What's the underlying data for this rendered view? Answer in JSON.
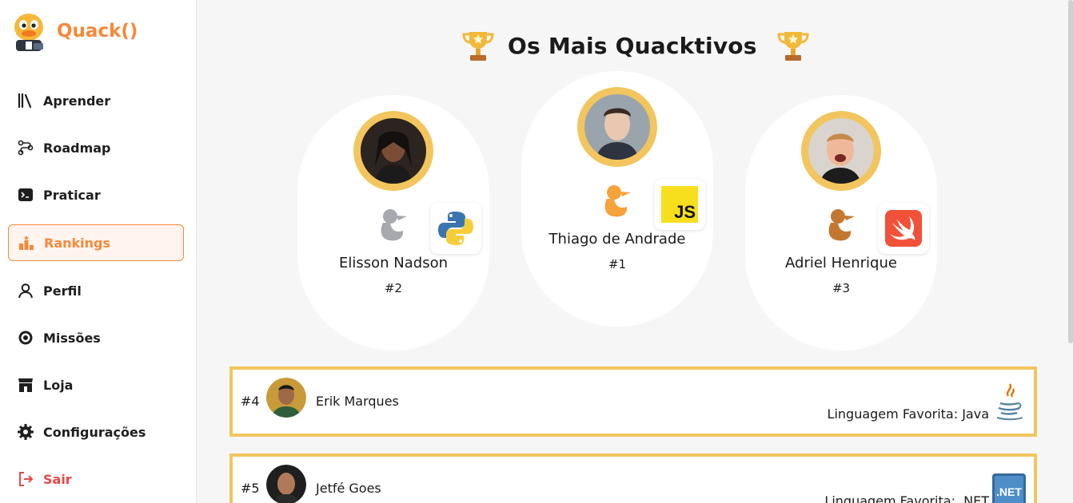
{
  "brand": {
    "name": "Quack()",
    "logo_icon": "duck-mascot-icon"
  },
  "nav": [
    {
      "label": "Aprender",
      "icon": "books-icon",
      "active": false
    },
    {
      "label": "Roadmap",
      "icon": "roadmap-icon",
      "active": false
    },
    {
      "label": "Praticar",
      "icon": "terminal-icon",
      "active": false
    },
    {
      "label": "Rankings",
      "icon": "podium-icon",
      "active": true
    },
    {
      "label": "Perfil",
      "icon": "user-icon",
      "active": false
    },
    {
      "label": "Missões",
      "icon": "target-icon",
      "active": false
    },
    {
      "label": "Loja",
      "icon": "store-icon",
      "active": false
    },
    {
      "label": "Configurações",
      "icon": "gear-icon",
      "active": false
    },
    {
      "label": "Sair",
      "icon": "logout-icon",
      "active": false
    }
  ],
  "page_title": "Os Mais Quacktivos",
  "podium": [
    {
      "name": "Elisson Nadson",
      "rank": "#2",
      "duck": "silver-duck-icon",
      "lang_icon": "python-icon"
    },
    {
      "name": "Thiago de Andrade",
      "rank": "#1",
      "duck": "gold-duck-icon",
      "lang_icon": "javascript-icon",
      "lang_text": "JS"
    },
    {
      "name": "Adriel Henrique",
      "rank": "#3",
      "duck": "bronze-duck-icon",
      "lang_icon": "swift-icon"
    }
  ],
  "list": [
    {
      "rank": "#4",
      "name": "Erik Marques",
      "favorite": "Linguagem Favorita: Java",
      "icon": "java-icon"
    },
    {
      "rank": "#5",
      "name": "Jetfé Goes",
      "favorite": "Linguagem Favorita: .NET",
      "icon": "dotnet-icon",
      "icon_text": ".NET"
    }
  ],
  "colors": {
    "accent": "#f5883a",
    "gold": "#f2c55e",
    "danger": "#e54848"
  }
}
